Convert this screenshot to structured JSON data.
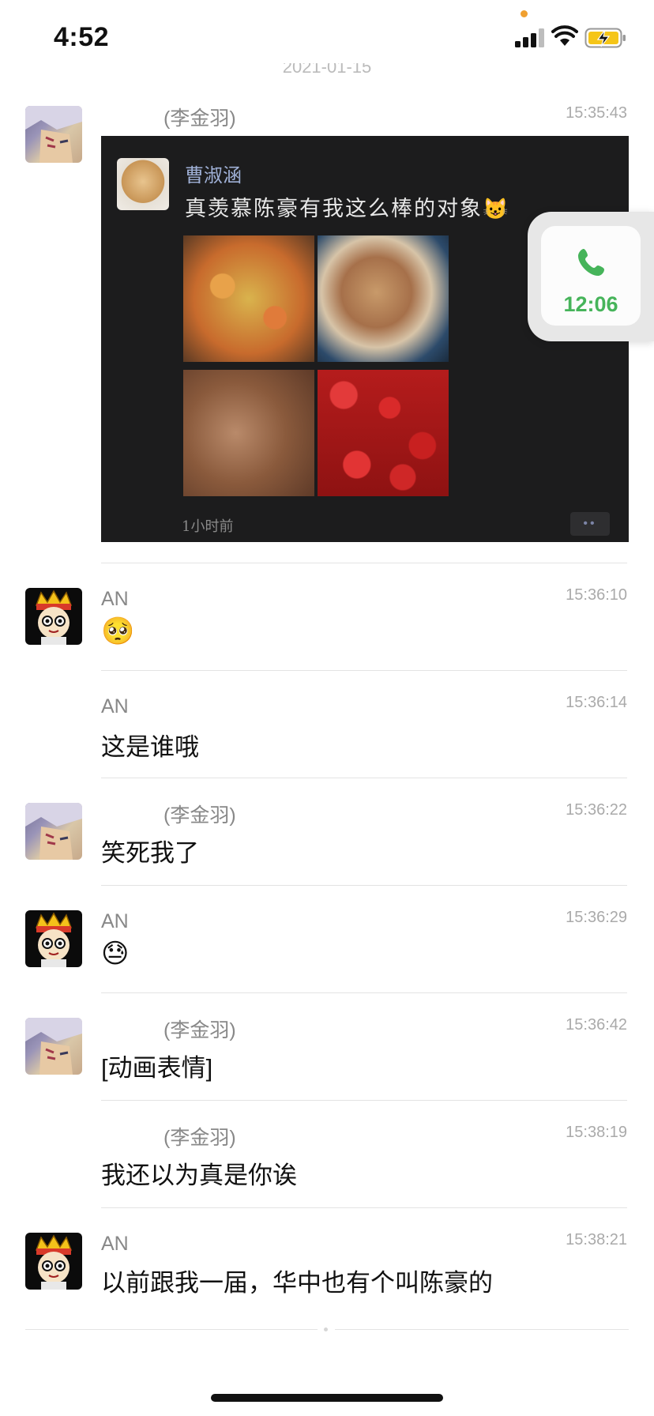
{
  "status_bar": {
    "time": "4:52"
  },
  "date_separator": "2021-01-15",
  "messages": [
    {
      "sender": "(李金羽)",
      "time": "15:35:43",
      "text": ""
    },
    {
      "sender": "AN",
      "time": "15:36:10",
      "text": "🥺"
    },
    {
      "sender": "AN",
      "time": "15:36:14",
      "text": "这是谁哦"
    },
    {
      "sender": "(李金羽)",
      "time": "15:36:22",
      "text": "笑死我了"
    },
    {
      "sender": "AN",
      "time": "15:36:29",
      "text": "😓"
    },
    {
      "sender": "(李金羽)",
      "time": "15:36:42",
      "text": "[动画表情]"
    },
    {
      "sender": "(李金羽)",
      "time": "15:38:19",
      "text": "我还以为真是你诶"
    },
    {
      "sender": "AN",
      "time": "15:38:21",
      "text": "以前跟我一届，华中也有个叫陈豪的"
    }
  ],
  "screenshot": {
    "name": "曹淑涵",
    "text": "真羡慕陈豪有我这么棒的对象",
    "cat_emoji": "😺",
    "time": "1小时前",
    "more": "••"
  },
  "call_widget": {
    "duration": "12:06"
  },
  "colors": {
    "call_green": "#46b45a",
    "divider": "#e3e3e3",
    "timestamp": "#aaaaaa"
  }
}
